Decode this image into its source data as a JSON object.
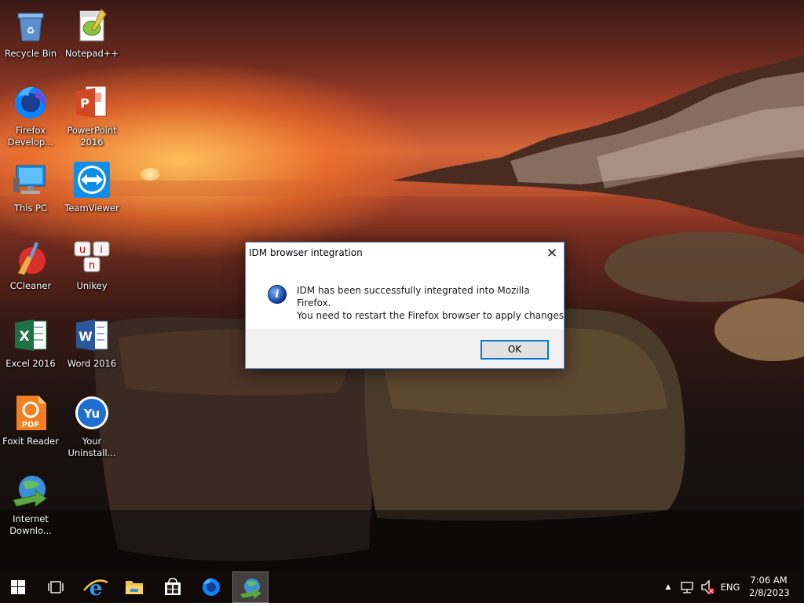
{
  "desktop": {
    "icons": [
      {
        "label": "Recycle Bin"
      },
      {
        "label": "Notepad++"
      },
      {
        "label": "Firefox Develop..."
      },
      {
        "label": "PowerPoint 2016"
      },
      {
        "label": "This PC"
      },
      {
        "label": "TeamViewer"
      },
      {
        "label": "CCleaner"
      },
      {
        "label": "Unikey"
      },
      {
        "label": "Excel 2016"
      },
      {
        "label": "Word 2016"
      },
      {
        "label": "Foxit Reader"
      },
      {
        "label": "Your Uninstall..."
      },
      {
        "label": "Internet Downlo..."
      }
    ],
    "icon_glyphs": {
      "excel": "X",
      "word": "W",
      "foxit": "PDF",
      "uninstaller": "Yu",
      "unikey_keys": [
        "u",
        "i",
        "n"
      ]
    }
  },
  "dialog": {
    "title": "IDM browser integration",
    "close_glyph": "✕",
    "info_glyph": "i",
    "message_line1": "IDM has been successfully integrated into Mozilla Firefox.",
    "message_line2": "You need to restart the Firefox browser to apply changes",
    "ok_label": "OK"
  },
  "taskbar": {
    "apps": [
      "start-button",
      "task-view-button",
      "internet-explorer",
      "file-explorer",
      "microsoft-store",
      "firefox-developer",
      "internet-download-manager"
    ],
    "active_app": "internet-download-manager",
    "tray": {
      "overflow_glyph": "▲",
      "network_icon": "network-icon",
      "volume_icon": "volume-muted-icon",
      "language": "ENG"
    },
    "clock": {
      "time": "7:06 AM",
      "date": "2/8/2023"
    }
  },
  "colors": {
    "accent": "#0078d7",
    "dialog_border": "#5b86c4",
    "taskbar": "#100a09"
  }
}
